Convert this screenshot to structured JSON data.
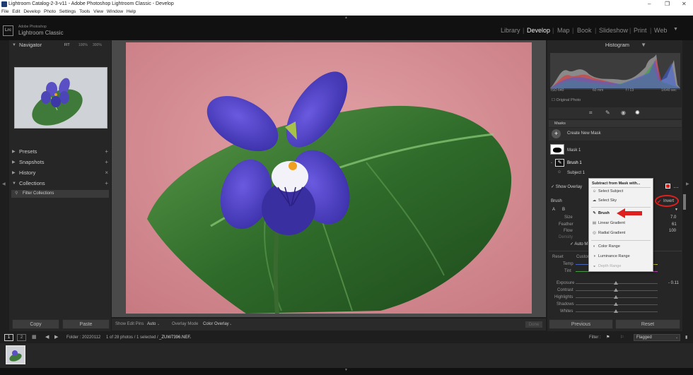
{
  "window": {
    "title": "Lightroom Catalog-2-3-v11 - Adobe Photoshop Lightroom Classic - Develop"
  },
  "menu": [
    "File",
    "Edit",
    "Develop",
    "Photo",
    "Settings",
    "Tools",
    "View",
    "Window",
    "Help"
  ],
  "identity": {
    "logo": "Lrc",
    "line1": "Adobe Photoshop",
    "line2": "Lightroom Classic"
  },
  "modules": [
    {
      "label": "Library"
    },
    {
      "label": "Develop"
    },
    {
      "label": "Map"
    },
    {
      "label": "Book"
    },
    {
      "label": "Slideshow"
    },
    {
      "label": "Print"
    },
    {
      "label": "Web"
    }
  ],
  "left": {
    "navigator": {
      "title": "Navigator",
      "fit": "FIT",
      "z1": "100%",
      "z2": "300%"
    },
    "presets": "Presets",
    "snapshots": "Snapshots",
    "history": "History",
    "collections": "Collections",
    "filter_collections": "Filter Collections",
    "copy": "Copy",
    "paste": "Paste"
  },
  "toolbar": {
    "show_edit_pins": "Show Edit Pins",
    "pins_value": "Auto",
    "overlay_mode": "Overlay Mode",
    "overlay_value": "Color Overlay",
    "done": "Done"
  },
  "right": {
    "histogram": "Histogram",
    "iso": "ISO 640",
    "focal": "60 mm",
    "aperture": "f / 13",
    "shutter": "1/640 sec",
    "original_photo": "Original Photo",
    "masks": "Masks",
    "create_new_mask": "Create New Mask",
    "mask1": "Mask 1",
    "brush1": "Brush 1",
    "subject1": "Subject 1",
    "show_overlay": "Show Overlay",
    "invert": "Invert",
    "brush_label": "Brush",
    "a": "A",
    "b": "B",
    "size": "Size",
    "feather": "Feather",
    "flow": "Flow",
    "density": "Density",
    "size_val": "7.0",
    "feather_val": "61",
    "flow_val": "100",
    "auto_mask": "Auto M",
    "reset": "Reset",
    "custom": "Custom",
    "temp": "Temp",
    "tint": "Tint",
    "exposure": "Exposure",
    "exposure_val": "- 0.11",
    "contrast": "Contrast",
    "highlights": "Highlights",
    "shadows": "Shadows",
    "whites": "Whites",
    "previous": "Previous",
    "reset_btn": "Reset"
  },
  "popup": {
    "title": "Subtract from Mask with...",
    "items": [
      "Select Subject",
      "Select Sky",
      "Brush",
      "Linear Gradient",
      "Radial Gradient",
      "Color Range",
      "Luminance Range",
      "Depth Range"
    ]
  },
  "filmbar": {
    "p1": "1",
    "p2": "2",
    "folder": "Folder : 20220112",
    "count": "1 of 28 photos / 1 selected / ",
    "file": "_ZUW7396.NEF",
    "filter": "Filter :",
    "flagged": "Flagged"
  },
  "colors": {
    "accent_red": "#e0201e",
    "bg": "#262626",
    "photo_bg": "#d0888e"
  }
}
